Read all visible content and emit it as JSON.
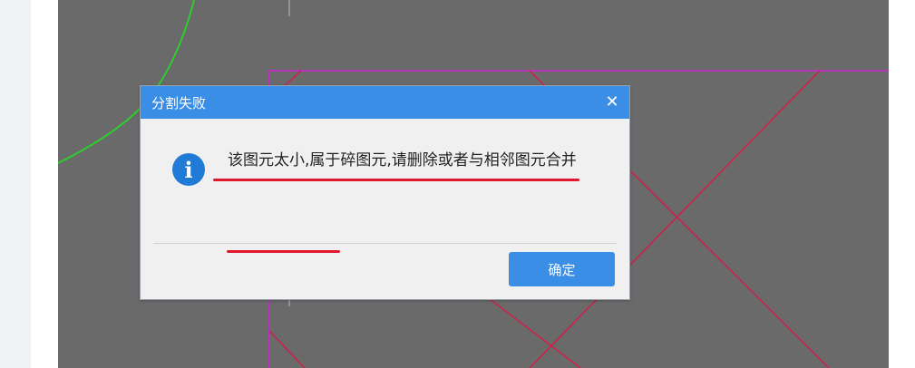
{
  "dialog": {
    "title": "分割失败",
    "close_symbol": "✕",
    "info_symbol": "i",
    "message": "该图元太小,属于碎图元,请删除或者与相邻图元合并",
    "ok_label": "确定"
  },
  "colors": {
    "titlebar": "#3a8ee6",
    "canvas": "#6a6a6a",
    "magenta_line": "#d020d0",
    "crimson_line": "#d0204a",
    "green_curve": "#2ecc2e",
    "annotation_underline": "#e0182d"
  },
  "icons": {
    "info": "info-icon",
    "close": "close-icon"
  }
}
